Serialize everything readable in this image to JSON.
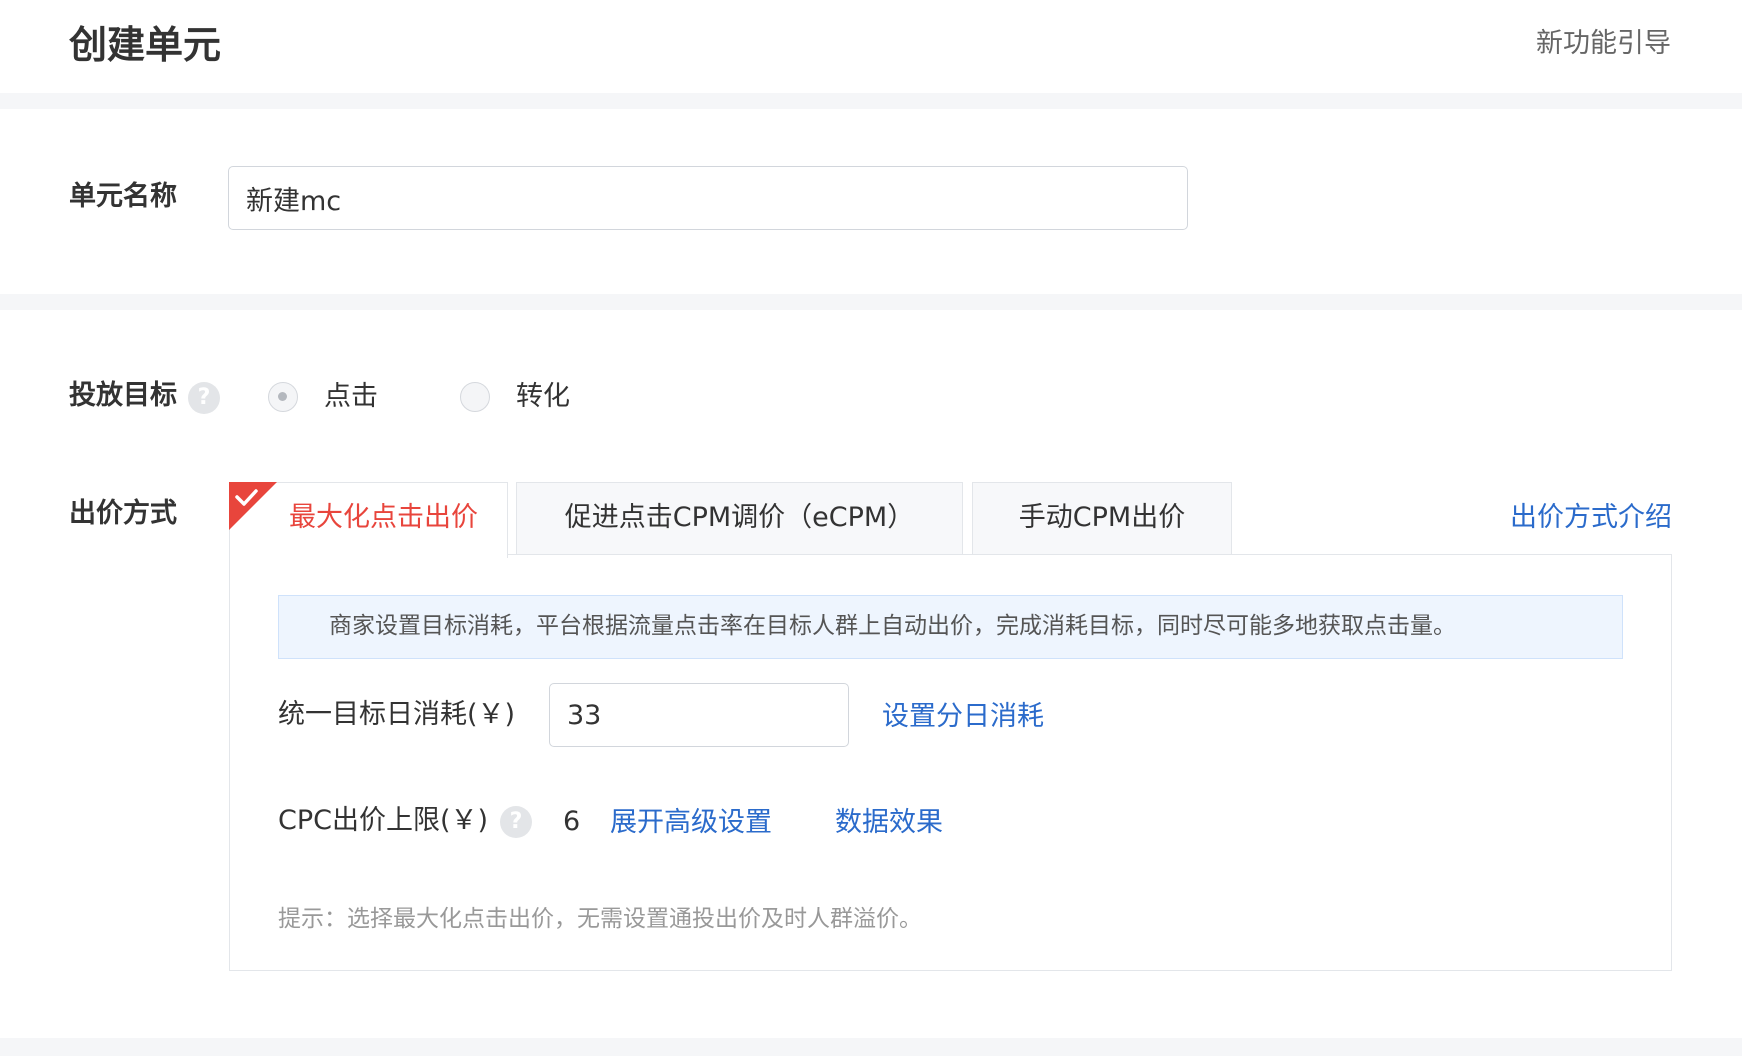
{
  "header": {
    "title": "创建单元",
    "guide_link": "新功能引导"
  },
  "unit_name": {
    "label": "单元名称",
    "value": "新建mc"
  },
  "target": {
    "label": "投放目标",
    "help_icon": "question-circle",
    "options": [
      {
        "label": "点击",
        "selected": true
      },
      {
        "label": "转化",
        "selected": false
      }
    ]
  },
  "bidding": {
    "label": "出价方式",
    "intro_link": "出价方式介绍",
    "tabs": [
      {
        "label": "最大化点击出价",
        "active": true
      },
      {
        "label": "促进点击CPM调价（eCPM）",
        "active": false
      },
      {
        "label": "手动CPM出价",
        "active": false
      }
    ],
    "banner": "商家设置目标消耗，平台根据流量点击率在目标人群上自动出价，完成消耗目标，同时尽可能多地获取点击量。",
    "daily_budget": {
      "label": "统一目标日消耗(￥)",
      "value": "33",
      "link": "设置分日消耗"
    },
    "cpc_limit": {
      "label": "CPC出价上限(￥)",
      "value": "6",
      "advanced_link": "展开高级设置",
      "data_link": "数据效果"
    },
    "hint": "提示：选择最大化点击出价，无需设置通投出价及时人群溢价。"
  },
  "colors": {
    "accent_red": "#e8453c",
    "link_blue": "#2b6bcb",
    "banner_bg": "#eef5fe",
    "page_bg": "#f5f6f8"
  }
}
